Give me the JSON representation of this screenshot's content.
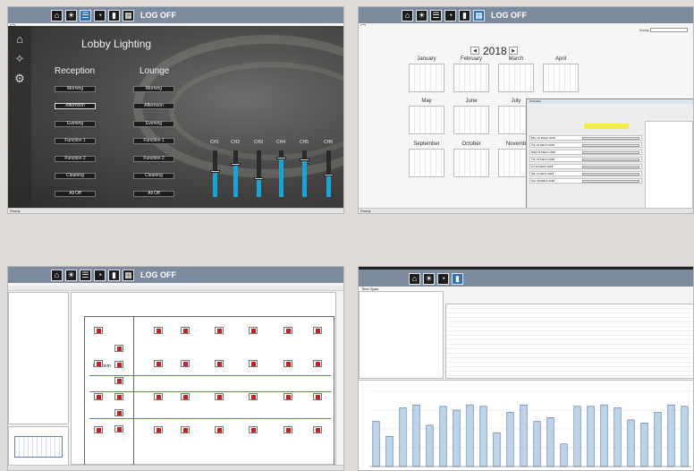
{
  "screens": {
    "lighting": {
      "nav_label": "LOG OFF",
      "title": "Lobby Lighting",
      "columns": [
        "Reception",
        "Lounge"
      ],
      "scenes": [
        "Morning",
        "Afternoon",
        "Evening",
        "Function 1",
        "Function 2",
        "Cleaning",
        "All Off"
      ],
      "selected_scene": "Afternoon",
      "channels": [
        {
          "label": "CH1",
          "level": 0.55
        },
        {
          "label": "CH2",
          "level": 0.72
        },
        {
          "label": "CH3",
          "level": 0.4
        },
        {
          "label": "CH4",
          "level": 0.85
        },
        {
          "label": "CH5",
          "level": 0.8
        },
        {
          "label": "CH6",
          "level": 0.48
        }
      ],
      "status": "Ready"
    },
    "calendar": {
      "nav_label": "LOG OFF",
      "year": "2018",
      "months_row1": [
        "January",
        "February",
        "March",
        "April"
      ],
      "months_row2": [
        "May",
        "June",
        "July"
      ],
      "months_row3": [
        "September",
        "October",
        "Novemb"
      ],
      "group_label": "Group",
      "dialog": {
        "title": "Overview",
        "rows": [
          "Mon 12 March 2018",
          "Tue 13 March 2018",
          "Wed 14 March 2018",
          "Thu 15 March 2018",
          "Fri 16 March 2018",
          "Sat 17 March 2018",
          "Sun 18 March 2018"
        ]
      },
      "status": "Ready"
    },
    "floorplan": {
      "nav_label": "LOG OFF",
      "room_label": "Ballroom",
      "status": ""
    },
    "energy": {
      "toolbar": "Time Span",
      "chart_data": {
        "type": "bar",
        "title": "",
        "values": [
          60,
          40,
          78,
          82,
          55,
          80,
          75,
          82,
          80,
          45,
          72,
          82,
          60,
          65,
          30,
          80,
          80,
          82,
          78,
          62,
          58,
          72,
          82,
          80
        ],
        "ylim": [
          0,
          100
        ]
      }
    }
  },
  "colors": {
    "accent": "#14a6d6",
    "fixture": "#d21c1c",
    "nav_active": "#2d6fb8"
  }
}
